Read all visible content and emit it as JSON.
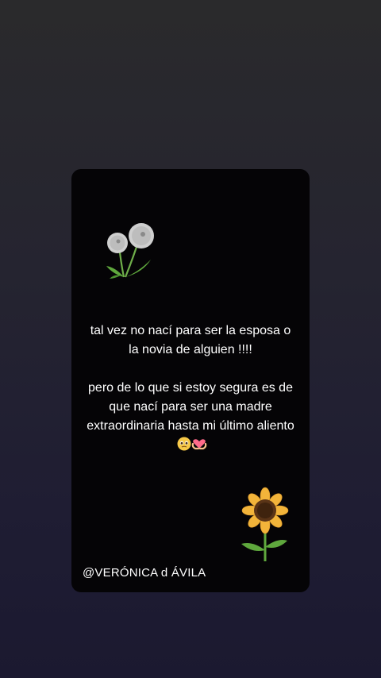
{
  "story": {
    "paragraph_1": "tal vez no nací para ser la esposa o la novia de alguien !!!!",
    "paragraph_2": "pero de lo que si estoy segura es de que nací para ser una madre extraordinaria hasta mi último aliento",
    "emojis": [
      "pleading-face-icon",
      "heart-hands-icon"
    ],
    "signature": "@VERÓNICA d ÁVILA"
  },
  "colors": {
    "background": "#25243a",
    "card": "#050406",
    "text": "#ffffff"
  }
}
